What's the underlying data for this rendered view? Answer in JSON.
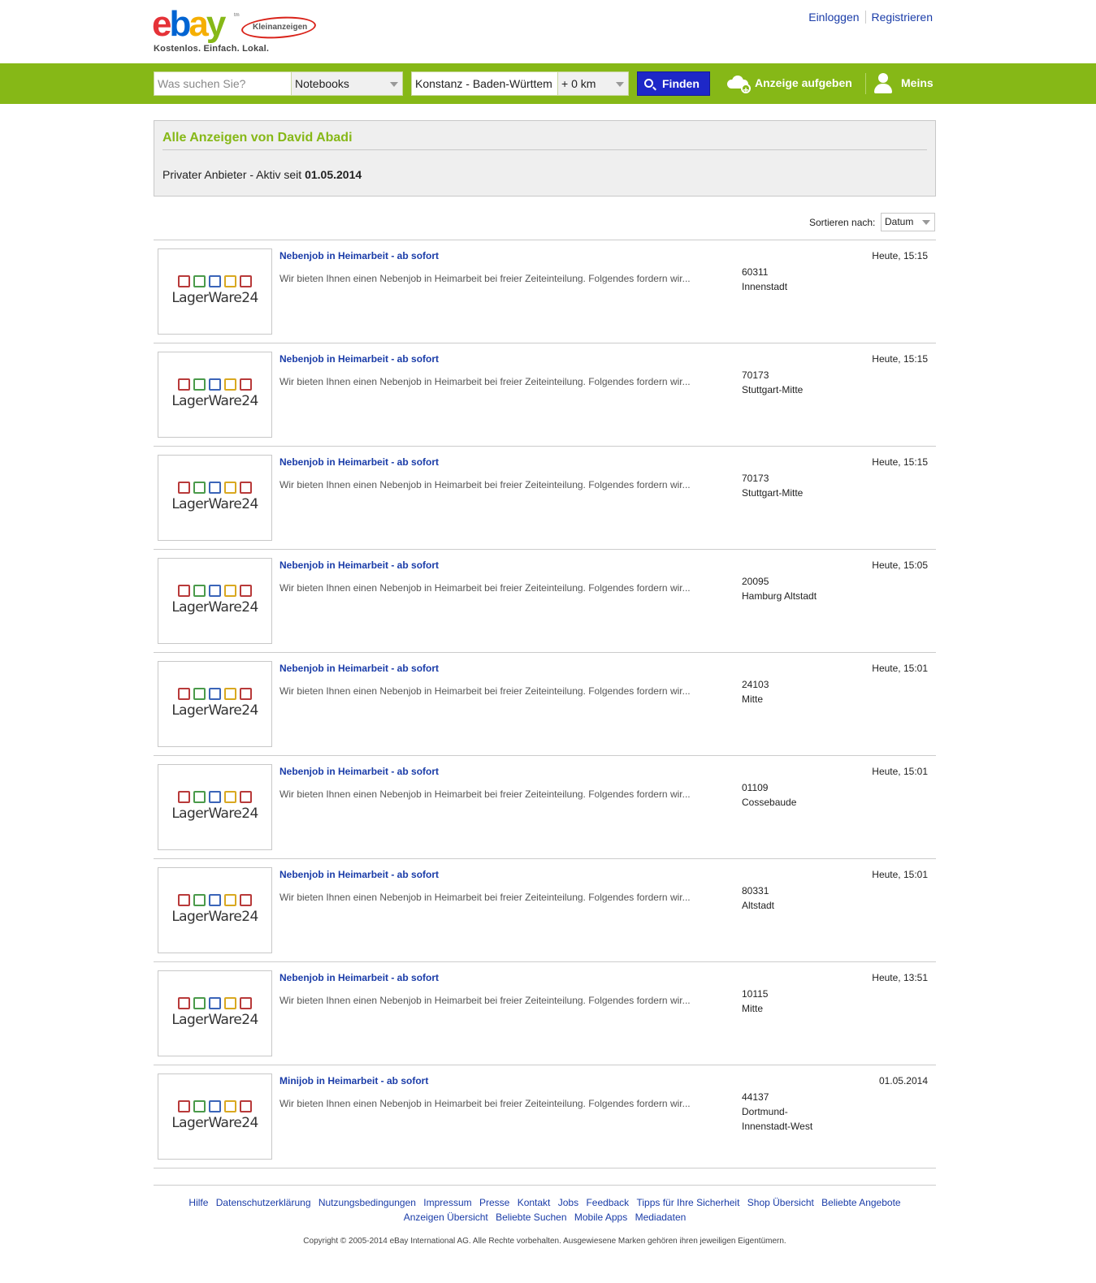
{
  "header": {
    "logo_letters": [
      "e",
      "b",
      "a",
      "y"
    ],
    "logo_colors": [
      "#e53238",
      "#0064d2",
      "#f5af02",
      "#86b817"
    ],
    "tm": "tm",
    "kleinanzeigen": "Kleinanzeigen",
    "slogan": "Kostenlos. Einfach. Lokal.",
    "login": "Einloggen",
    "register": "Registrieren"
  },
  "searchbar": {
    "query_placeholder": "Was suchen Sie?",
    "category": "Notebooks",
    "location": "Konstanz - Baden-Württem",
    "radius": "+ 0 km",
    "find_label": "Finden",
    "post_ad_label": "Anzeige aufgeben",
    "meins_label": "Meins",
    "accent_color": "#86b817",
    "button_color": "#1e28c8"
  },
  "profile": {
    "title": "Alle Anzeigen von David Abadi",
    "since_prefix": "Privater Anbieter - Aktiv seit ",
    "since_date": "01.05.2014"
  },
  "sort": {
    "label": "Sortieren nach:",
    "value": "Datum"
  },
  "listings": [
    {
      "title": "Nebenjob in Heimarbeit - ab sofort",
      "desc": "Wir bieten Ihnen einen Nebenjob in Heimarbeit bei freier Zeiteinteilung. Folgendes fordern wir...",
      "zip": "60311",
      "city": "Innenstadt",
      "date": "Heute, 15:15",
      "thumb": "LagerWare24"
    },
    {
      "title": "Nebenjob in Heimarbeit - ab sofort",
      "desc": "Wir bieten Ihnen einen Nebenjob in Heimarbeit bei freier Zeiteinteilung. Folgendes fordern wir...",
      "zip": "70173",
      "city": "Stuttgart-Mitte",
      "date": "Heute, 15:15",
      "thumb": "LagerWare24"
    },
    {
      "title": "Nebenjob in Heimarbeit - ab sofort",
      "desc": "Wir bieten Ihnen einen Nebenjob in Heimarbeit bei freier Zeiteinteilung. Folgendes fordern wir...",
      "zip": "70173",
      "city": "Stuttgart-Mitte",
      "date": "Heute, 15:15",
      "thumb": "LagerWare24"
    },
    {
      "title": "Nebenjob in Heimarbeit - ab sofort",
      "desc": "Wir bieten Ihnen einen Nebenjob in Heimarbeit bei freier Zeiteinteilung. Folgendes fordern wir...",
      "zip": "20095",
      "city": "Hamburg Altstadt",
      "date": "Heute, 15:05",
      "thumb": "LagerWare24"
    },
    {
      "title": "Nebenjob in Heimarbeit - ab sofort",
      "desc": "Wir bieten Ihnen einen Nebenjob in Heimarbeit bei freier Zeiteinteilung. Folgendes fordern wir...",
      "zip": "24103",
      "city": "Mitte",
      "date": "Heute, 15:01",
      "thumb": "LagerWare24"
    },
    {
      "title": "Nebenjob in Heimarbeit - ab sofort",
      "desc": "Wir bieten Ihnen einen Nebenjob in Heimarbeit bei freier Zeiteinteilung. Folgendes fordern wir...",
      "zip": "01109",
      "city": "Cossebaude",
      "date": "Heute, 15:01",
      "thumb": "LagerWare24"
    },
    {
      "title": "Nebenjob in Heimarbeit - ab sofort",
      "desc": "Wir bieten Ihnen einen Nebenjob in Heimarbeit bei freier Zeiteinteilung. Folgendes fordern wir...",
      "zip": "80331",
      "city": "Altstadt",
      "date": "Heute, 15:01",
      "thumb": "LagerWare24"
    },
    {
      "title": "Nebenjob in Heimarbeit - ab sofort",
      "desc": "Wir bieten Ihnen einen Nebenjob in Heimarbeit bei freier Zeiteinteilung. Folgendes fordern wir...",
      "zip": "10115",
      "city": "Mitte",
      "date": "Heute, 13:51",
      "thumb": "LagerWare24"
    },
    {
      "title": "Minijob in Heimarbeit - ab sofort",
      "desc": "Wir bieten Ihnen einen Nebenjob in Heimarbeit bei freier Zeiteinteilung. Folgendes fordern wir...",
      "zip": "44137",
      "city": "Dortmund-Innenstadt-West",
      "city_lines": [
        "Dortmund-",
        "Innenstadt-West"
      ],
      "date": "01.05.2014",
      "thumb": "LagerWare24"
    }
  ],
  "thumb_square_colors": [
    "#b83a3a",
    "#4a9a4a",
    "#3a64b8",
    "#d9a820",
    "#b83a3a"
  ],
  "footer": {
    "links": [
      "Hilfe",
      "Datenschutzerklärung",
      "Nutzungsbedingungen",
      "Impressum",
      "Presse",
      "Kontakt",
      "Jobs",
      "Feedback",
      "Tipps für Ihre Sicherheit",
      "Shop Übersicht",
      "Beliebte Angebote",
      "Anzeigen Übersicht",
      "Beliebte Suchen",
      "Mobile Apps",
      "Mediadaten"
    ],
    "copyright": "Copyright © 2005-2014 eBay International AG. Alle Rechte vorbehalten. Ausgewiesene Marken gehören ihren jeweiligen Eigentümern."
  }
}
